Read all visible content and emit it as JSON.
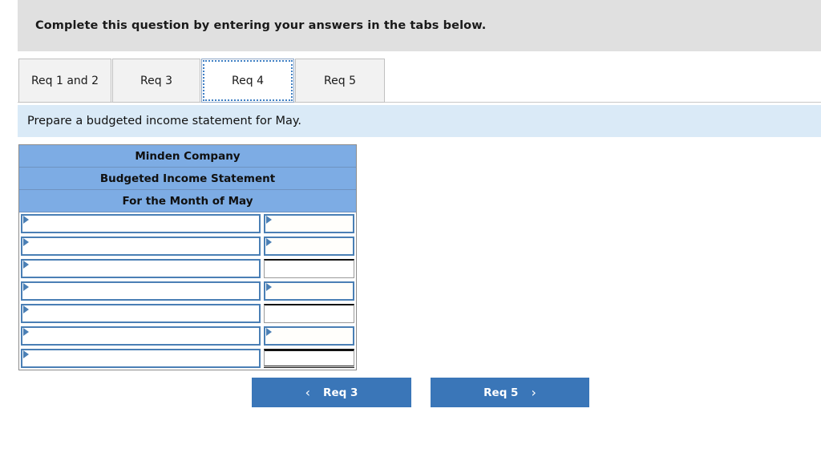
{
  "banner": {
    "text": "Complete this question by entering your answers in the tabs below."
  },
  "tabs": [
    {
      "label": "Req 1 and 2",
      "active": false
    },
    {
      "label": "Req 3",
      "active": false
    },
    {
      "label": "Req 4",
      "active": true
    },
    {
      "label": "Req 5",
      "active": false
    }
  ],
  "prompt": {
    "text": "Prepare a budgeted income statement for May."
  },
  "statement": {
    "headers": [
      "Minden Company",
      "Budgeted Income Statement",
      "For the Month of May"
    ],
    "rows": [
      {
        "label": "",
        "amount": "",
        "label_input": true,
        "amount_input": true,
        "amount_rule": "none"
      },
      {
        "label": "",
        "amount": "",
        "label_input": true,
        "amount_input": true,
        "amount_rule": "none"
      },
      {
        "label": "",
        "amount": "",
        "label_input": true,
        "amount_input": false,
        "amount_rule": "top"
      },
      {
        "label": "",
        "amount": "",
        "label_input": true,
        "amount_input": true,
        "amount_rule": "none"
      },
      {
        "label": "",
        "amount": "",
        "label_input": true,
        "amount_input": false,
        "amount_rule": "top"
      },
      {
        "label": "",
        "amount": "",
        "label_input": true,
        "amount_input": true,
        "amount_rule": "none"
      },
      {
        "label": "",
        "amount": "",
        "label_input": true,
        "amount_input": false,
        "amount_rule": "total"
      }
    ],
    "colors": {
      "header_blue": "#7dace4",
      "input_border": "#4a7fb5"
    }
  },
  "nav": {
    "prev_label": "Req 3",
    "prev_icon": "‹",
    "next_label": "Req 5",
    "next_icon": "›",
    "accent": "#3a76b8"
  }
}
